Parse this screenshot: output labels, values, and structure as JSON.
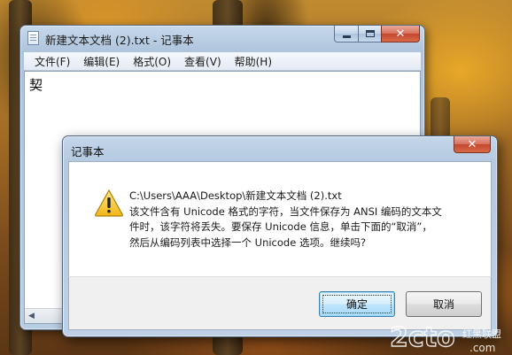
{
  "notepad": {
    "title": "新建文本文档 (2).txt - 记事本",
    "menu": [
      "文件(F)",
      "编辑(E)",
      "格式(O)",
      "查看(V)",
      "帮助(H)"
    ],
    "content": "契",
    "caption": {
      "minimize": "minimize-icon",
      "maximize": "maximize-icon",
      "close": "✕"
    }
  },
  "dialog": {
    "title": "记事本",
    "close": "✕",
    "icon": "warning-icon",
    "message": {
      "path": "C:\\Users\\AAA\\Desktop\\新建文本文档 (2).txt",
      "line1": "该文件含有 Unicode 格式的字符，当文件保存为 ANSI 编码的文本文",
      "line2": "件时，该字符将丢失。要保存 Unicode 信息，单击下面的“取消”，",
      "line3": "然后从编码列表中选择一个 Unicode 选项。继续吗?"
    },
    "buttons": {
      "ok": "确定",
      "cancel": "取消"
    }
  },
  "watermark": {
    "brand": "2cto",
    "sub": "红黑联盟",
    "domain": ".com"
  },
  "colors": {
    "close_red": "#c4462e",
    "accent_blue": "#3c7fb1"
  }
}
